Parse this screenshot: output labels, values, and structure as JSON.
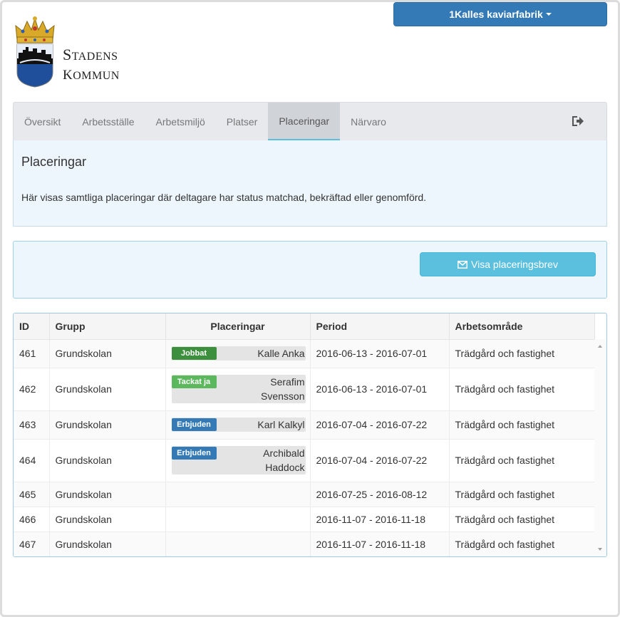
{
  "company_menu": {
    "label": "1Kalles kaviarfabrik"
  },
  "brand": {
    "line1_initial": "S",
    "line1_rest": "tadens",
    "line2_initial": "K",
    "line2_rest": "ommun"
  },
  "nav": {
    "items": [
      {
        "label": "Översikt"
      },
      {
        "label": "Arbetsställe"
      },
      {
        "label": "Arbetsmiljö"
      },
      {
        "label": "Platser"
      },
      {
        "label": "Placeringar",
        "active": true
      },
      {
        "label": "Närvaro"
      }
    ],
    "logout_icon": "sign-out-icon"
  },
  "info": {
    "title": "Placeringar",
    "text": "Här visas samtliga placeringar där deltagare har status matchad, bekräftad eller genomförd."
  },
  "action": {
    "letter_button": "Visa placeringsbrev",
    "icon": "envelope-icon"
  },
  "table": {
    "headers": {
      "id": "ID",
      "group": "Grupp",
      "placements": "Placeringar",
      "period": "Period",
      "area": "Arbetsområde"
    },
    "rows": [
      {
        "id": "461",
        "group": "Grundskolan",
        "status": "Jobbat",
        "status_color": "#3c8f3c",
        "name1": "Kalle Anka",
        "name2": "",
        "period": "2016-06-13 - 2016-07-01",
        "area": "Trädgård och fastighet"
      },
      {
        "id": "462",
        "group": "Grundskolan",
        "status": "Tackat ja",
        "status_color": "#5cb85c",
        "name1": "Serafim",
        "name2": "Svensson",
        "period": "2016-06-13 - 2016-07-01",
        "area": "Trädgård och fastighet"
      },
      {
        "id": "463",
        "group": "Grundskolan",
        "status": "Erbjuden",
        "status_color": "#337ab7",
        "name1": "Karl Kalkyl",
        "name2": "",
        "period": "2016-07-04 - 2016-07-22",
        "area": "Trädgård och fastighet"
      },
      {
        "id": "464",
        "group": "Grundskolan",
        "status": "Erbjuden",
        "status_color": "#337ab7",
        "name1": "Archibald",
        "name2": "Haddock",
        "period": "2016-07-04 - 2016-07-22",
        "area": "Trädgård och fastighet"
      },
      {
        "id": "465",
        "group": "Grundskolan",
        "period": "2016-07-25 - 2016-08-12",
        "area": "Trädgård och fastighet"
      },
      {
        "id": "466",
        "group": "Grundskolan",
        "period": "2016-11-07 - 2016-11-18",
        "area": "Trädgård och fastighet"
      },
      {
        "id": "467",
        "group": "Grundskolan",
        "period": "2016-11-07 - 2016-11-18",
        "area": "Trädgård och fastighet"
      }
    ]
  }
}
